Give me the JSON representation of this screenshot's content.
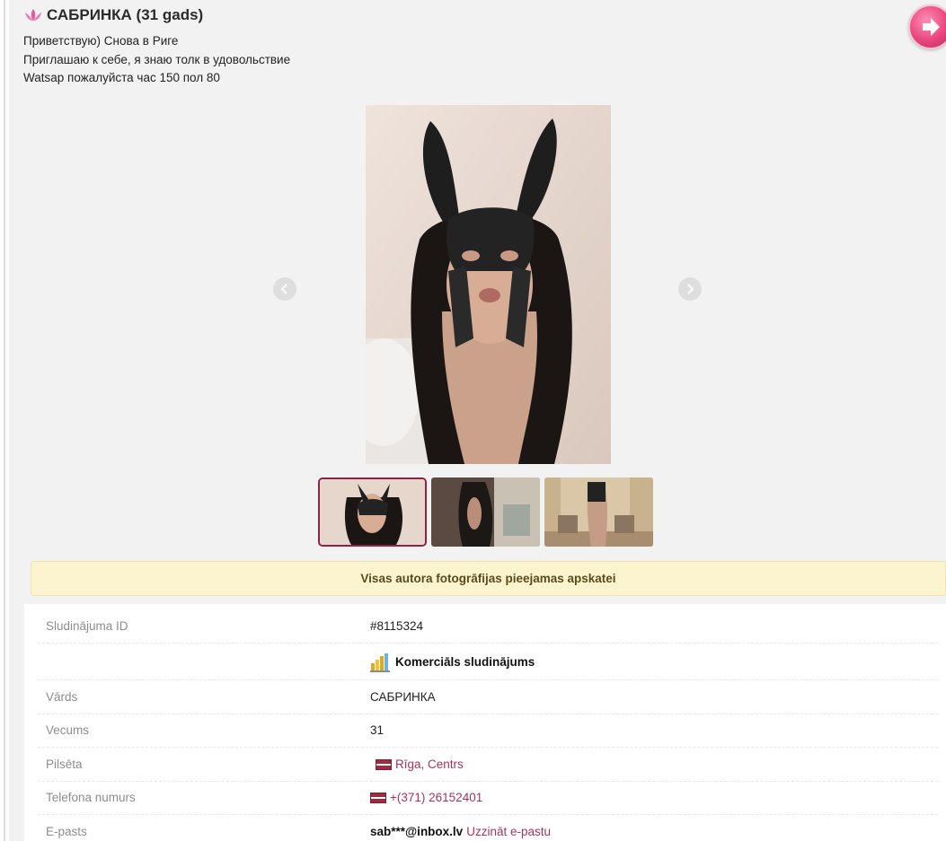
{
  "header": {
    "title": "САБРИНКА (31 gads)",
    "lotus_icon": "lotus-icon",
    "next_icon": "arrow-right-icon"
  },
  "description": [
    "Приветствую) Снова в Риге",
    "Приглашаю к себе, я знаю толк в удовольствие",
    "Watsap пожалуйста час 150 пол 80"
  ],
  "gallery": {
    "prev_icon": "chevron-left-icon",
    "next_icon": "chevron-right-icon",
    "thumbnails": [
      "photo-1",
      "photo-2",
      "photo-3"
    ],
    "active_index": 0
  },
  "notice": "Visas autora fotogrāfijas pieejamas apskatei",
  "details": {
    "id": {
      "label": "Sludinājuma ID",
      "value": "#8115324"
    },
    "commercial": {
      "label": "",
      "value": "Komerciāls sludinājums",
      "icon": "bar-chart-icon"
    },
    "name": {
      "label": "Vārds",
      "value": "САБРИНКА"
    },
    "age": {
      "label": "Vecums",
      "value": "31"
    },
    "city": {
      "label": "Pilsēta",
      "value": "Rīga, Centrs",
      "flag": "latvia-flag-icon"
    },
    "phone": {
      "label": "Telefona numurs",
      "value": "+(371) 26152401",
      "flag": "latvia-flag-icon"
    },
    "email": {
      "label": "E-pasts",
      "value": "sab***@inbox.lv",
      "link": "Uzzināt e-pastu"
    }
  },
  "colors": {
    "accent": "#a6335b",
    "notice_bg": "#fcf4cf",
    "card_bg": "#f2f2f2"
  }
}
